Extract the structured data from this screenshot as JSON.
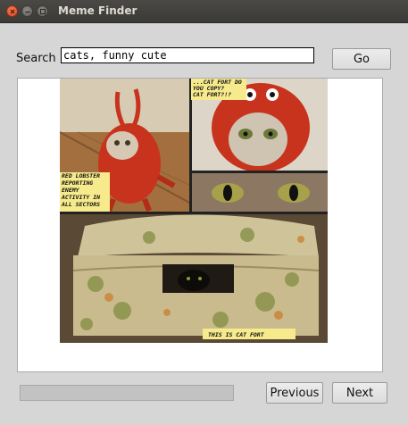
{
  "window": {
    "title": "Meme Finder"
  },
  "search": {
    "label": "Search",
    "value": "cats, funny cute"
  },
  "buttons": {
    "go": "Go",
    "previous": "Previous",
    "next": "Next"
  },
  "progress": {
    "fraction": 0
  },
  "meme": {
    "caption_top": [
      "...CAT FORT DO",
      "YOU COPY?",
      "CAT FORT?!?"
    ],
    "caption_left": [
      "RED LOBSTER",
      "REPORTING",
      "ENEMY",
      "ACTIVITY IN",
      "ALL SECTORS"
    ],
    "caption_bottom": "THIS IS CAT FORT"
  }
}
